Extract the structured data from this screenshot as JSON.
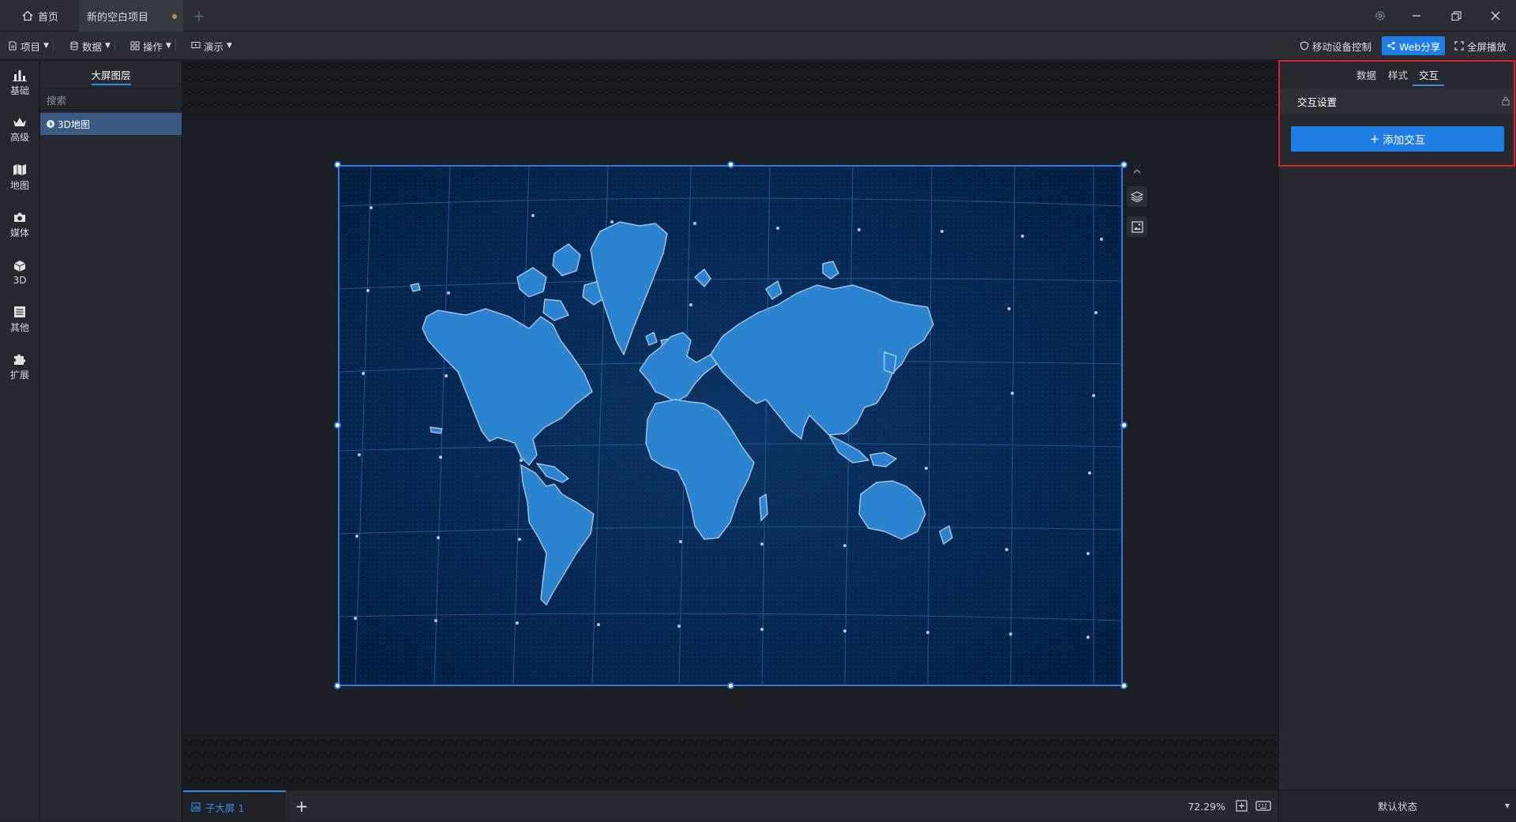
{
  "titlebar": {
    "home_label": "首页",
    "project_tab_label": "新的空白项目",
    "add_tab": "+"
  },
  "menubar": {
    "items": [
      {
        "label": "项目"
      },
      {
        "label": "数据"
      },
      {
        "label": "操作"
      },
      {
        "label": "演示"
      }
    ],
    "mobile_control": "移动设备控制",
    "web_share": "Web分享",
    "fullscreen_play": "全屏播放"
  },
  "categories": [
    {
      "label": "基础",
      "icon": "bar-chart-icon"
    },
    {
      "label": "高级",
      "icon": "crown-icon"
    },
    {
      "label": "地图",
      "icon": "map-icon"
    },
    {
      "label": "媒体",
      "icon": "camera-icon"
    },
    {
      "label": "3D",
      "icon": "cube-icon"
    },
    {
      "label": "其他",
      "icon": "list-icon"
    },
    {
      "label": "扩展",
      "icon": "puzzle-icon"
    }
  ],
  "layers": {
    "title": "大屏图层",
    "search_placeholder": "搜索",
    "items": [
      {
        "label": "3D地图"
      }
    ]
  },
  "right_panel": {
    "tabs": [
      "数据",
      "样式",
      "交互"
    ],
    "active_tab": "交互",
    "section_title": "交互设置",
    "add_button": "添加交互",
    "state_label": "默认状态"
  },
  "bottombar": {
    "screen_tab": "子大屏 1",
    "zoom": "72.29%"
  },
  "colors": {
    "accent": "#1f7de6",
    "highlight_border": "#d6262c",
    "map_land": "#2c83cf",
    "map_bg": "#072854"
  }
}
